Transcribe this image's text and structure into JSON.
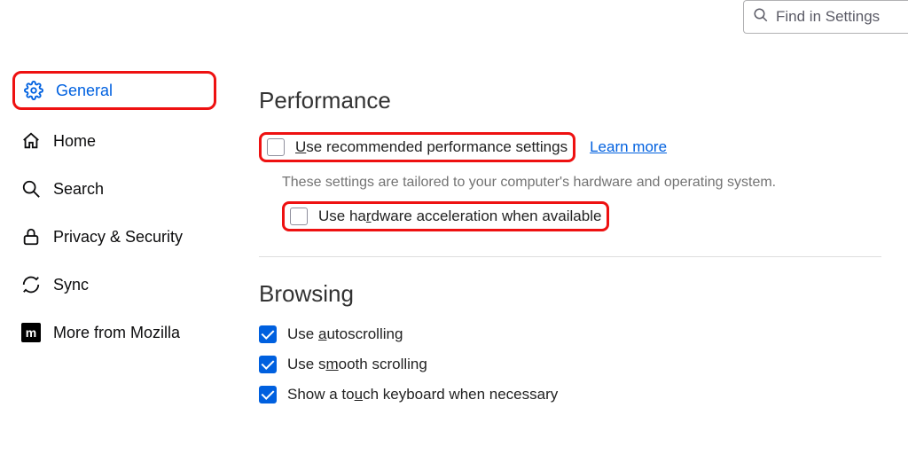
{
  "search": {
    "placeholder": "Find in Settings"
  },
  "sidebar": {
    "items": [
      {
        "label": "General"
      },
      {
        "label": "Home"
      },
      {
        "label": "Search"
      },
      {
        "label": "Privacy & Security"
      },
      {
        "label": "Sync"
      },
      {
        "label": "More from Mozilla"
      }
    ]
  },
  "sections": {
    "performance": {
      "title": "Performance",
      "recommended_prefix": "",
      "recommended_u": "U",
      "recommended_rest": "se recommended performance settings",
      "learn_more": "Learn more",
      "hint": "These settings are tailored to your computer's hardware and operating system.",
      "hw_prefix": "Use ha",
      "hw_u": "r",
      "hw_rest": "dware acceleration when available"
    },
    "browsing": {
      "title": "Browsing",
      "auto_prefix": "Use ",
      "auto_u": "a",
      "auto_rest": "utoscrolling",
      "smooth_prefix": "Use s",
      "smooth_u": "m",
      "smooth_rest": "ooth scrolling",
      "touch_prefix": "Show a to",
      "touch_u": "u",
      "touch_rest": "ch keyboard when necessary"
    }
  }
}
